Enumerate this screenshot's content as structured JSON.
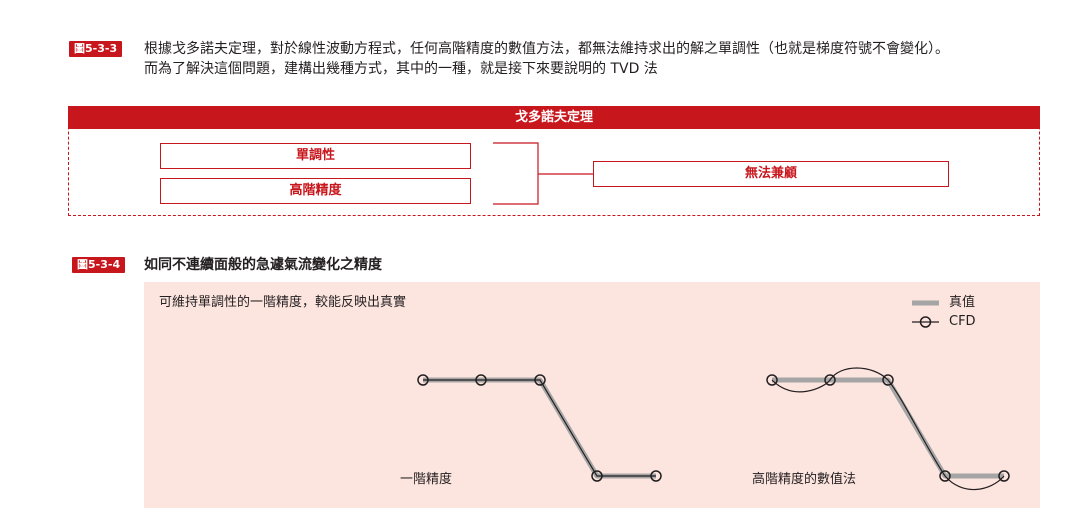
{
  "fig1": {
    "badge": "圖5-3-3",
    "text_line1": "根據戈多諾夫定理，對於線性波動方程式，任何高階精度的數值方法，都無法維持求出的解之單調性（也就是梯度符號不會變化）。",
    "text_line2": "而為了解決這個問題，建構出幾種方式，其中的一種，就是接下來要說明的 TVD 法"
  },
  "diagram": {
    "header": "戈多諾夫定理",
    "box_monotonic": "單調性",
    "box_high_order": "高階精度",
    "box_result": "無法兼顧",
    "accent_color": "#c8161d"
  },
  "fig2": {
    "badge": "圖5-3-4",
    "title": "如同不連續面般的急遽氣流變化之精度",
    "note": "可維持單調性的一階精度，較能反映出真實",
    "legend": {
      "true_value": "真值",
      "cfd": "CFD"
    },
    "left_caption": "一階精度",
    "right_caption": "高階精度的數值法",
    "panel_color": "#fde5df"
  }
}
